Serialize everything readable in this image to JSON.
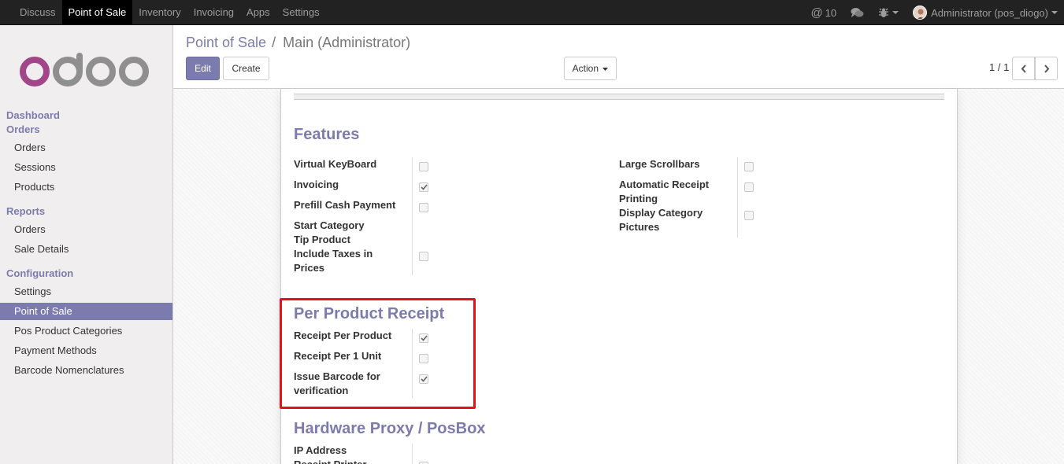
{
  "topnav": {
    "items": [
      {
        "label": "Discuss",
        "active": false
      },
      {
        "label": "Point of Sale",
        "active": true
      },
      {
        "label": "Inventory",
        "active": false
      },
      {
        "label": "Invoicing",
        "active": false
      },
      {
        "label": "Apps",
        "active": false
      },
      {
        "label": "Settings",
        "active": false
      }
    ],
    "mentions_count": "10",
    "user": "Administrator (pos_diogo)"
  },
  "sidebar": {
    "dashboard": "Dashboard",
    "orders_heading": "Orders",
    "orders": [
      "Orders",
      "Sessions",
      "Products"
    ],
    "reports_heading": "Reports",
    "reports": [
      "Orders",
      "Sale Details"
    ],
    "config_heading": "Configuration",
    "config": [
      "Settings",
      "Point of Sale",
      "Pos Product Categories",
      "Payment Methods",
      "Barcode Nomenclatures"
    ],
    "active_item": "Point of Sale"
  },
  "breadcrumb": {
    "parent": "Point of Sale",
    "separator": "/",
    "current": "Main (Administrator)"
  },
  "buttons": {
    "edit": "Edit",
    "create": "Create",
    "action": "Action"
  },
  "pager": "1 / 1",
  "features": {
    "title": "Features",
    "left": [
      {
        "label": "Virtual KeyBoard",
        "checked": false
      },
      {
        "label": "Invoicing",
        "checked": true
      },
      {
        "label": "Prefill Cash Payment",
        "checked": false
      },
      {
        "label": "Start Category"
      },
      {
        "label": "Tip Product"
      },
      {
        "label": "Include Taxes in Prices",
        "checked": false
      }
    ],
    "right": [
      {
        "label": "Large Scrollbars",
        "checked": false
      },
      {
        "label": "Automatic Receipt Printing",
        "checked": false
      },
      {
        "label": "Display Category Pictures",
        "checked": false
      }
    ]
  },
  "per_product_receipt": {
    "title": "Per Product Receipt",
    "fields": [
      {
        "label": "Receipt Per Product",
        "checked": true
      },
      {
        "label": "Receipt Per 1 Unit",
        "checked": false
      },
      {
        "label": "Issue Barcode for verification",
        "checked": true
      }
    ]
  },
  "hardware": {
    "title": "Hardware Proxy / PosBox",
    "fields": [
      {
        "label": "IP Address"
      },
      {
        "label": "Receipt Printer"
      }
    ]
  },
  "colors": {
    "brand": "#7c7bad",
    "highlight": "#e3121b",
    "topbar": "#222222"
  }
}
